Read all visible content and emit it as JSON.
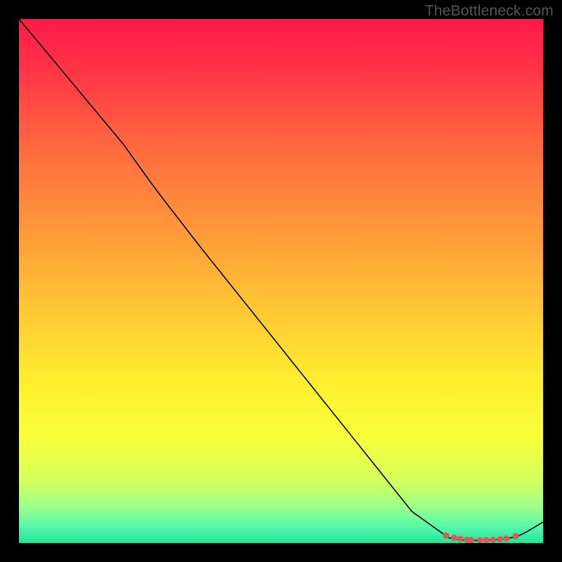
{
  "watermark": "TheBottleneck.com",
  "chart_data": {
    "type": "line",
    "title": "",
    "xlabel": "",
    "ylabel": "",
    "xlim": [
      0,
      100
    ],
    "ylim": [
      0,
      100
    ],
    "background_gradient": {
      "stops": [
        {
          "offset": 0.0,
          "color": "#ff1a4b"
        },
        {
          "offset": 0.1,
          "color": "#ff3547"
        },
        {
          "offset": 0.25,
          "color": "#ff6b3f"
        },
        {
          "offset": 0.4,
          "color": "#ff983a"
        },
        {
          "offset": 0.55,
          "color": "#ffc634"
        },
        {
          "offset": 0.7,
          "color": "#fff02f"
        },
        {
          "offset": 0.8,
          "color": "#f8ff3a"
        },
        {
          "offset": 0.88,
          "color": "#d4ff5c"
        },
        {
          "offset": 0.93,
          "color": "#9fff88"
        },
        {
          "offset": 0.97,
          "color": "#55f7aa"
        },
        {
          "offset": 1.0,
          "color": "#21e39c"
        }
      ]
    },
    "series": [
      {
        "name": "main-curve",
        "color": "#000000",
        "width": 1.6,
        "x": [
          0,
          5,
          10,
          15,
          20,
          25,
          28,
          35,
          45,
          55,
          65,
          75,
          82,
          85,
          88,
          92,
          95,
          97,
          100
        ],
        "values": [
          100,
          94,
          88,
          82,
          76,
          69,
          65,
          56,
          43.5,
          31,
          18.5,
          6,
          1,
          0.5,
          0.5,
          0.7,
          1.2,
          2.2,
          4
        ]
      }
    ],
    "markers": {
      "name": "bottom-dots",
      "color": "#d85a5a",
      "radius_px": 4.5,
      "x": [
        81.5,
        83.0,
        84.2,
        85.5,
        86.3,
        88.0,
        89.2,
        90.5,
        91.8,
        93.0,
        94.8
      ],
      "values": [
        1.4,
        1.0,
        0.8,
        0.6,
        0.55,
        0.5,
        0.55,
        0.6,
        0.7,
        0.85,
        1.3
      ]
    }
  }
}
